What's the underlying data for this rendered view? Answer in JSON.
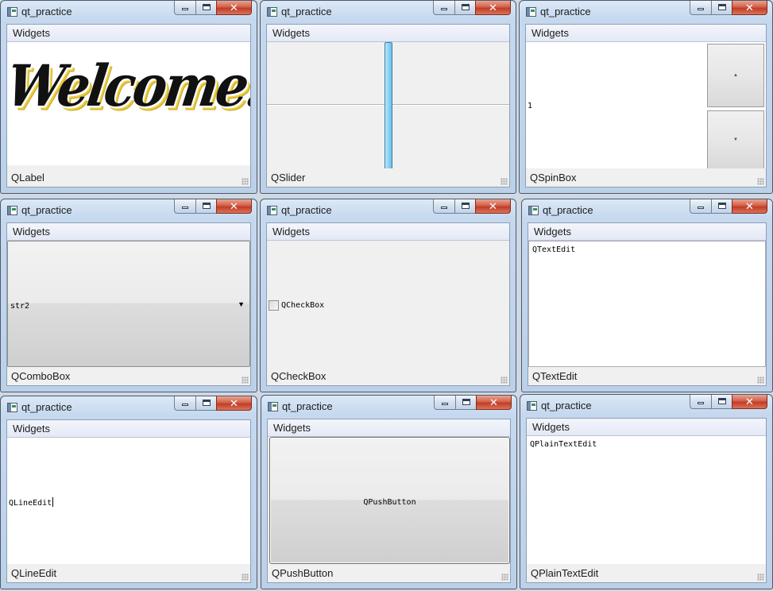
{
  "windows": [
    {
      "title": "qt_practice",
      "menu": "Widgets",
      "status": "QLabel",
      "content": "Welcome!"
    },
    {
      "title": "qt_practice",
      "menu": "Widgets",
      "status": "QSlider"
    },
    {
      "title": "qt_practice",
      "menu": "Widgets",
      "status": "QSpinBox",
      "content": "1"
    },
    {
      "title": "qt_practice",
      "menu": "Widgets",
      "status": "QComboBox",
      "content": "str2"
    },
    {
      "title": "qt_practice",
      "menu": "Widgets",
      "status": "QCheckBox",
      "content": "QCheckBox"
    },
    {
      "title": "qt_practice",
      "menu": "Widgets",
      "status": "QTextEdit",
      "content": "QTextEdit"
    },
    {
      "title": "qt_practice",
      "menu": "Widgets",
      "status": "QLineEdit",
      "content": "QLineEdit"
    },
    {
      "title": "qt_practice",
      "menu": "Widgets",
      "status": "QPushButton",
      "content": "QPushButton"
    },
    {
      "title": "qt_practice",
      "menu": "Widgets",
      "status": "QPlainTextEdit",
      "content": "QPlainTextEdit"
    }
  ],
  "caption_buttons": {
    "minimize_icon": "minimize-icon",
    "maximize_icon": "maximize-icon",
    "close_glyph": "✕"
  },
  "colors": {
    "close_button": "#c8432c",
    "slider_handle": "#8fd3f2",
    "welcome_outline": "#e9cd3f"
  }
}
